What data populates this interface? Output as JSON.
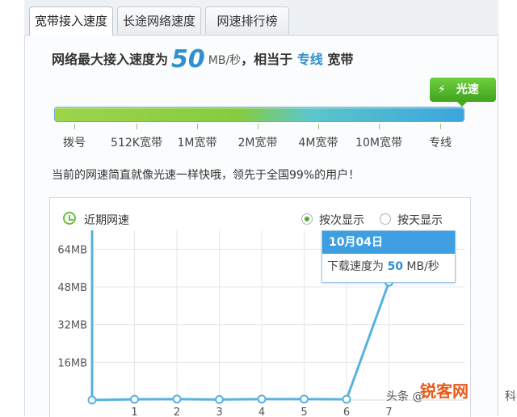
{
  "tabs": [
    {
      "label": "宽带接入速度",
      "active": true
    },
    {
      "label": "长途网络速度",
      "active": false
    },
    {
      "label": "网速排行榜",
      "active": false
    }
  ],
  "headline": {
    "prefix": "网络最大接入速度为",
    "value": "50",
    "unit": "MB/秒",
    "middle": "，相当于",
    "highlight": "专线",
    "suffix": "宽带"
  },
  "badge": {
    "label": "光速",
    "icon": "lightning-icon"
  },
  "speed_scale": [
    "拨号",
    "512K宽带",
    "1M宽带",
    "2M宽带",
    "4M宽带",
    "10M宽带",
    "专线"
  ],
  "note": "当前的网速简直就像光速一样快哦，领先于全国99%的用户！",
  "recent": {
    "title": "近期网速",
    "icon": "clock-icon"
  },
  "view_options": [
    {
      "label": "按次显示",
      "selected": true
    },
    {
      "label": "按天显示",
      "selected": false
    }
  ],
  "tooltip": {
    "date": "10月04日",
    "label": "下载速度为",
    "value": "50",
    "unit": "MB/秒"
  },
  "watermark": {
    "text": "头条 @",
    "logo": "锐客网",
    "suffix": "科普"
  },
  "colors": {
    "accent": "#3d9fe2",
    "green": "#4caf2a",
    "line": "#57b2e0"
  },
  "chart_data": {
    "type": "line",
    "x": [
      0,
      1,
      2,
      3,
      4,
      5,
      6,
      7
    ],
    "x_tick_labels": [
      "1",
      "2",
      "3",
      "4",
      "5",
      "6",
      "7"
    ],
    "values": [
      0,
      0.3,
      0.4,
      0.2,
      0.4,
      0.4,
      0.3,
      50
    ],
    "y_ticks": [
      "16MB",
      "32MB",
      "48MB",
      "64MB"
    ],
    "y_tick_values": [
      16,
      32,
      48,
      64
    ],
    "ylim": [
      0,
      72
    ],
    "grid": true
  }
}
